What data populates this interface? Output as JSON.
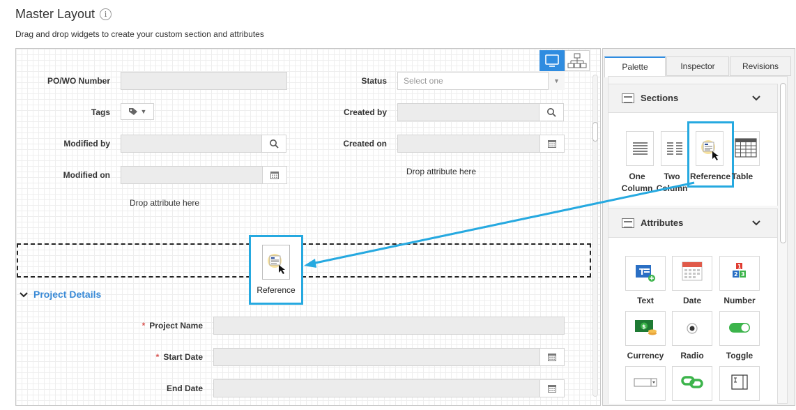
{
  "page": {
    "title": "Master Layout",
    "subtitle": "Drag and drop widgets to create your custom section and attributes"
  },
  "form": {
    "po_wo_number_label": "PO/WO Number",
    "status_label": "Status",
    "status_placeholder": "Select one",
    "tags_label": "Tags",
    "created_by_label": "Created by",
    "modified_by_label": "Modified by",
    "created_on_label": "Created on",
    "modified_on_label": "Modified on",
    "drop_attribute_left": "Drop attribute here",
    "drop_attribute_right": "Drop attribute here"
  },
  "drag_ghost": {
    "label": "Reference"
  },
  "project_section": {
    "title": "Project Details",
    "project_name_label": "Project Name",
    "start_date_label": "Start Date",
    "end_date_label": "End Date",
    "required_marker": "*"
  },
  "panel": {
    "tabs": [
      {
        "label": "Palette",
        "active": true
      },
      {
        "label": "Inspector",
        "active": false
      },
      {
        "label": "Revisions",
        "active": false
      }
    ],
    "sections_group": {
      "title": "Sections",
      "widgets": [
        {
          "label": "One Column",
          "icon": "one-column-icon"
        },
        {
          "label": "Two Column",
          "icon": "two-column-icon"
        },
        {
          "label": "Reference",
          "icon": "reference-icon"
        },
        {
          "label": "Table",
          "icon": "table-icon"
        }
      ]
    },
    "attributes_group": {
      "title": "Attributes",
      "widgets": [
        {
          "label": "Text",
          "icon": "text-field-icon"
        },
        {
          "label": "Date",
          "icon": "calendar-icon"
        },
        {
          "label": "Number",
          "icon": "number-icon"
        },
        {
          "label": "Currency",
          "icon": "currency-icon"
        },
        {
          "label": "Radio",
          "icon": "radio-icon"
        },
        {
          "label": "Toggle",
          "icon": "toggle-icon"
        }
      ]
    }
  },
  "colors": {
    "accent": "#2f8ce0",
    "highlight": "#26a9e0",
    "section_title": "#3a8ad6",
    "required": "#d9534f"
  }
}
